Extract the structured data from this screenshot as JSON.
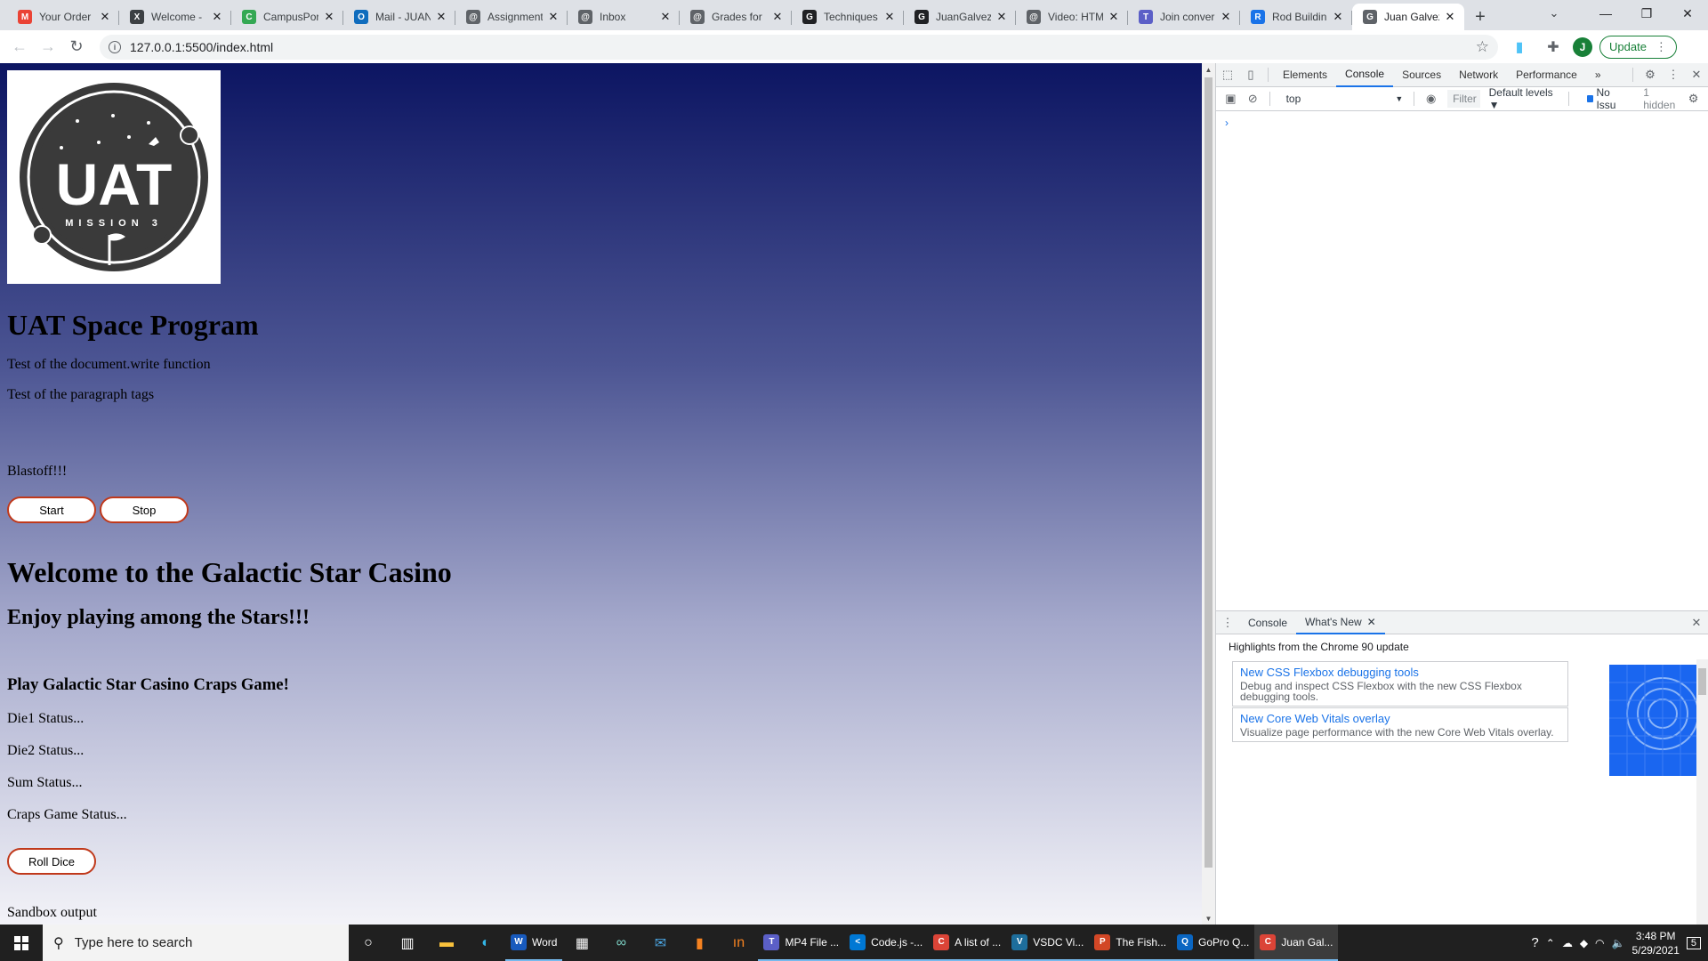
{
  "browser": {
    "tabs": [
      {
        "title": "Your Order",
        "fav": "M",
        "color": "#ea4335"
      },
      {
        "title": "Welcome -",
        "fav": "X",
        "color": "#3c4043"
      },
      {
        "title": "CampusPor",
        "fav": "C",
        "color": "#34a853"
      },
      {
        "title": "Mail - JUAN",
        "fav": "O",
        "color": "#0f6cbd"
      },
      {
        "title": "Assignment",
        "fav": "@",
        "color": "#5f6368"
      },
      {
        "title": "Inbox",
        "fav": "@",
        "color": "#5f6368"
      },
      {
        "title": "Grades for",
        "fav": "@",
        "color": "#5f6368"
      },
      {
        "title": "Techniques",
        "fav": "G",
        "color": "#202124"
      },
      {
        "title": "JuanGalvez",
        "fav": "G",
        "color": "#202124"
      },
      {
        "title": "Video: HTM",
        "fav": "@",
        "color": "#5f6368"
      },
      {
        "title": "Join conver",
        "fav": "T",
        "color": "#5b5fc7"
      },
      {
        "title": "Rod Buildin",
        "fav": "R",
        "color": "#1a73e8"
      },
      {
        "title": "Juan Galvez",
        "fav": "G",
        "color": "#5f6368",
        "active": true
      }
    ],
    "new_tab": "+",
    "url": "127.0.0.1:5500/index.html",
    "avatar_initial": "J",
    "update_label": "Update",
    "window_controls": {
      "minimize": "—",
      "restore": "❐",
      "close": "✕"
    }
  },
  "page": {
    "logo": {
      "text": "UAT",
      "subtext": "MISSION 3"
    },
    "title": "UAT Space Program",
    "write_text": "Test of the document.write function",
    "paragraph_text": "Test of the paragraph tags",
    "blastoff": "Blastoff!!!",
    "start_label": "Start",
    "stop_label": "Stop",
    "casino_title": "Welcome to the Galactic Star Casino",
    "casino_subtitle": "Enjoy playing among the Stars!!!",
    "craps_heading": "Play Galactic Star Casino Craps Game!",
    "die1_status": "Die1 Status...",
    "die2_status": "Die2 Status...",
    "sum_status": "Sum Status...",
    "craps_status": "Craps Game Status...",
    "roll_label": "Roll Dice",
    "sandbox": "Sandbox output"
  },
  "devtools": {
    "tabs": [
      "Elements",
      "Console",
      "Sources",
      "Network",
      "Performance"
    ],
    "active_tab": "Console",
    "more": "»",
    "context": "top",
    "filter_placeholder": "Filter",
    "levels": "Default levels ▼",
    "issues": "No Issu",
    "hidden": "1 hidden",
    "prompt": "›",
    "drawer": {
      "tabs": [
        "Console",
        "What's New"
      ],
      "active_tab": "What's New",
      "highlights": "Highlights from the Chrome 90 update",
      "cards": [
        {
          "title": "New CSS Flexbox debugging tools",
          "desc": "Debug and inspect CSS Flexbox with the new CSS Flexbox debugging tools."
        },
        {
          "title": "New Core Web Vitals overlay",
          "desc": "Visualize page performance with the new Core Web Vitals overlay."
        }
      ]
    }
  },
  "taskbar": {
    "search_placeholder": "Type here to search",
    "apps": [
      {
        "label": "Word",
        "color": "#185abd",
        "icon": "W"
      },
      {
        "label": "MP4 File ...",
        "color": "#5b5fc7",
        "icon": "T"
      },
      {
        "label": "Code.js -...",
        "color": "#0078d4",
        "icon": "<"
      },
      {
        "label": "A list of ...",
        "color": "#db4437",
        "icon": "C"
      },
      {
        "label": "VSDC Vi...",
        "color": "#1e6e9c",
        "icon": "V"
      },
      {
        "label": "The Fish...",
        "color": "#d24726",
        "icon": "P"
      },
      {
        "label": "GoPro Q...",
        "color": "#0a66c2",
        "icon": "Q"
      },
      {
        "label": "Juan Gal...",
        "color": "#db4437",
        "icon": "C",
        "active": true
      }
    ],
    "time": "3:48 PM",
    "date": "5/29/2021",
    "notifications": "5"
  }
}
